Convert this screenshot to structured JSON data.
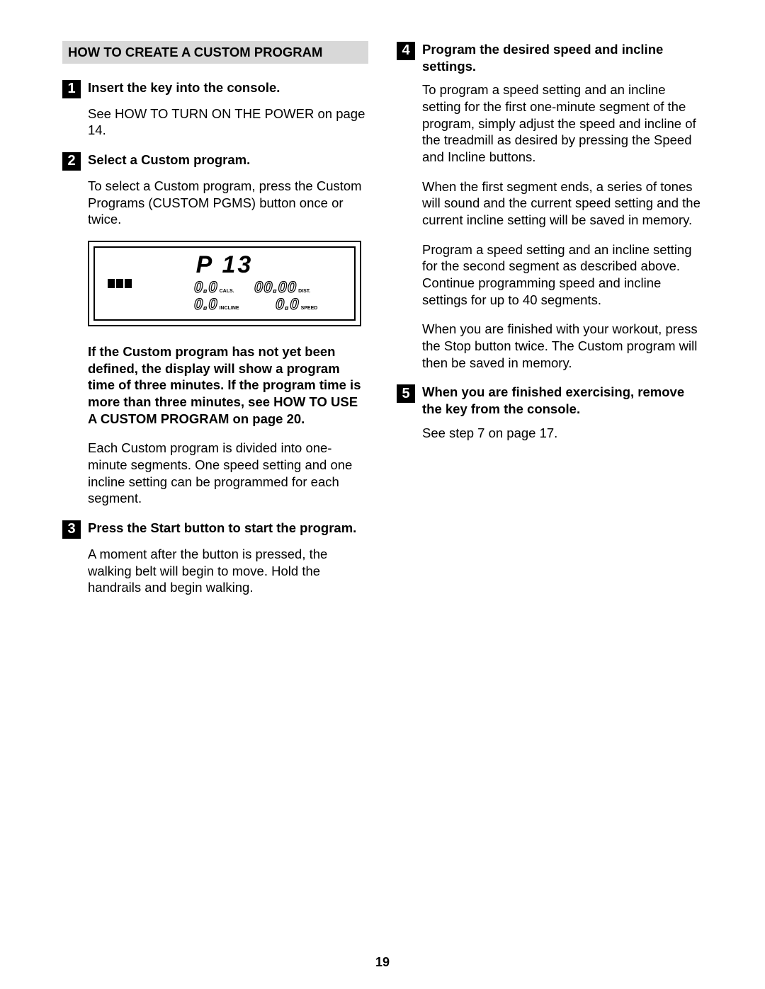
{
  "section_title": "HOW TO CREATE A CUSTOM PROGRAM",
  "page_number": "19",
  "left": {
    "step1": {
      "num": "1",
      "title": "Insert the key into the console.",
      "body": "See HOW TO TURN ON THE POWER on page 14."
    },
    "step2": {
      "num": "2",
      "title": "Select a Custom program.",
      "body": "To select a Custom program, press the Custom Programs (CUSTOM PGMS) button once or twice."
    },
    "lcd": {
      "main": "P 13",
      "cals_val": "0.0",
      "cals_label": "CALS.",
      "dist_val": "00.00",
      "dist_label": "DIST.",
      "incl_val": "0.0",
      "incl_label": "INCLINE",
      "speed_val": "0.0",
      "speed_label": "SPEED"
    },
    "note_bold": "If the Custom program has not yet been defined, the display will show a program time of three minutes. If the program time is more than three minutes, see HOW TO USE A CUSTOM PROGRAM on page 20.",
    "note_body": "Each Custom program is divided into one-minute segments. One speed setting and one incline setting can be programmed for each segment.",
    "step3": {
      "num": "3",
      "title": "Press the Start button to start the program.",
      "body": "A moment after the button is pressed, the walking belt will begin to move. Hold the handrails and begin walking."
    }
  },
  "right": {
    "step4": {
      "num": "4",
      "title": "Program the desired speed and incline settings.",
      "p1": "To program a speed setting and an incline setting for the first one-minute segment of the program, simply adjust the speed and incline of the treadmill as desired by pressing the Speed and Incline buttons.",
      "p2": "When the first segment ends, a series of tones will sound and the current speed setting and the current incline setting will be saved in memory.",
      "p3": "Program a speed setting and an incline setting for the second segment as described above. Continue programming speed and incline settings for up to 40 segments.",
      "p4": "When you are finished with your workout, press the Stop button twice. The Custom program will then be saved in memory."
    },
    "step5": {
      "num": "5",
      "title": "When you are finished exercising, remove the key from the console.",
      "body": "See step 7 on page 17."
    }
  }
}
